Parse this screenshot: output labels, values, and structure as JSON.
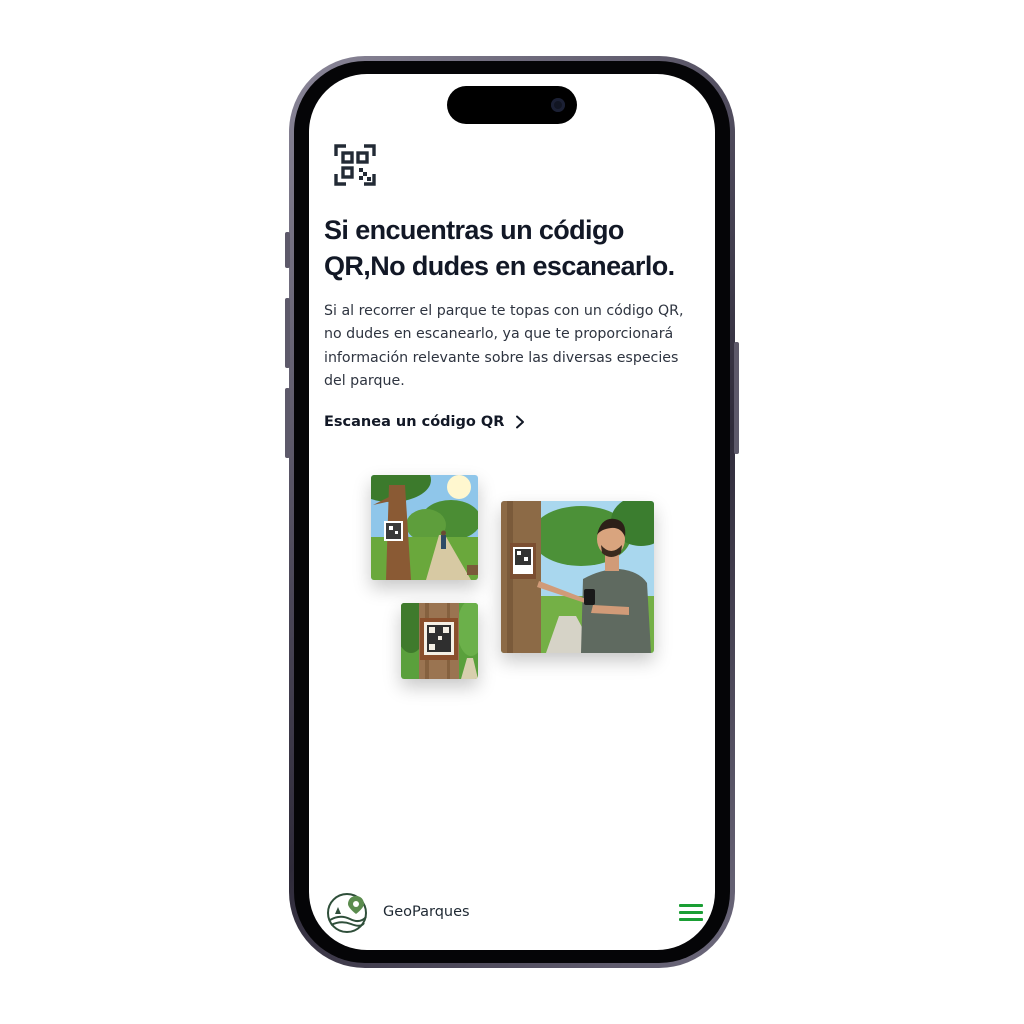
{
  "device": {
    "model": "iPhone"
  },
  "header": {
    "icon": "qr-code-icon"
  },
  "hero": {
    "title": "Si encuentras un código QR,No dudes en escanearlo.",
    "description": "Si al recorrer el parque te topas con un código QR, no dudes en escanearlo, ya que te proporcionará información relevante sobre las diversas especies del parque.",
    "cta_label": "Escanea un código QR",
    "cta_icon": "chevron-right-icon"
  },
  "gallery": {
    "images": [
      {
        "name": "park-path-tree-qr-image"
      },
      {
        "name": "man-scanning-qr-image"
      },
      {
        "name": "tree-qr-sign-closeup-image"
      }
    ]
  },
  "footer": {
    "logo": "geoparques-logo",
    "brand_name": "GeoParques",
    "menu_icon": "hamburger-menu-icon",
    "accent_color": "#1a9e34"
  },
  "colors": {
    "text_dark": "#121826",
    "frame": "#4b4758"
  }
}
